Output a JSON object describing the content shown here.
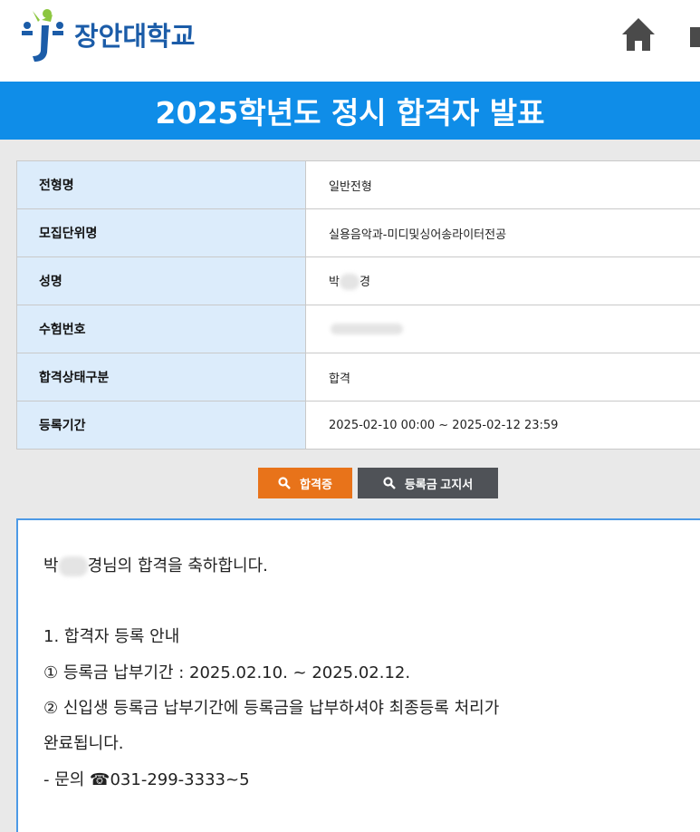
{
  "header": {
    "logo_text": "장안대학교",
    "home_icon": "home-icon"
  },
  "banner": {
    "title": "2025학년도 정시 합격자 발표"
  },
  "result": {
    "rows": [
      {
        "label": "전형명",
        "value": "일반전형"
      },
      {
        "label": "모집단위명",
        "value": "실용음악과-미디및싱어송라이터전공"
      },
      {
        "label": "성명",
        "value_prefix": "박",
        "value_suffix": "경"
      },
      {
        "label": "수험번호",
        "value": ""
      },
      {
        "label": "합격상태구분",
        "value": "합격"
      },
      {
        "label": "등록기간",
        "value": "2025-02-10 00:00 ~ 2025-02-12 23:59"
      }
    ]
  },
  "buttons": {
    "pass_label": "합격증",
    "fee_label": "등록금 고지서"
  },
  "notice": {
    "greeting_prefix": "박",
    "greeting_suffix": "경님의 합격을 축하합니다.",
    "section_title": "1. 합격자 등록 안내",
    "line1": "① 등록금 납부기간 : 2025.02.10. ~ 2025.02.12.",
    "line2": "② 신입생 등록금 납부기간에 등록금을 납부하셔야 최종등록 처리가",
    "line3": "완료됩니다.",
    "contact": "- 문의 ☎031-299-3333~5"
  },
  "colors": {
    "banner": "#0f8de8",
    "label_bg": "#dcecfb",
    "pass_button": "#e8731a",
    "fee_button": "#4f5257",
    "logo_text": "#1b5ca8"
  }
}
